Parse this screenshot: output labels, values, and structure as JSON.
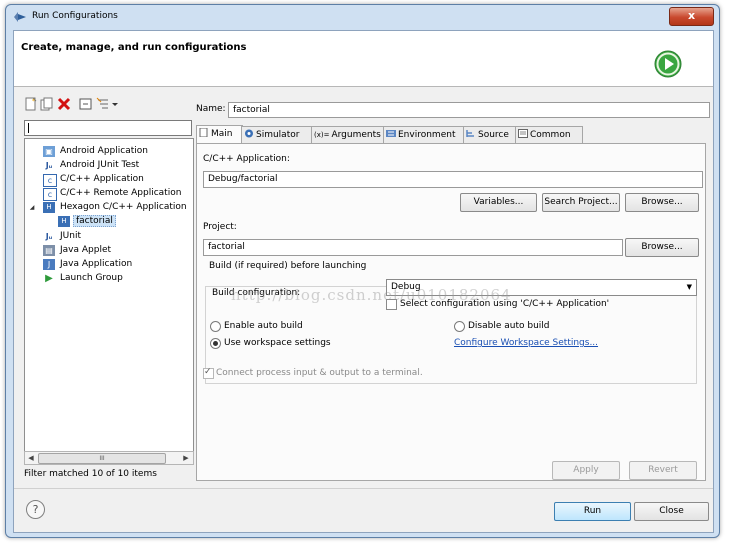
{
  "window": {
    "title": "Run Configurations",
    "close_glyph": "x"
  },
  "header": {
    "title": "Create, manage, and run configurations",
    "logo_icon": "run-icon"
  },
  "left": {
    "toolbar_icons": [
      "new-config-icon",
      "duplicate-icon",
      "delete-icon",
      "collapse-all-icon",
      "filter-icon",
      "dropdown-arrow-icon"
    ],
    "filter_value": "",
    "tree": [
      {
        "label": "Android Application",
        "icon": "android-app-icon",
        "level": 1,
        "expanded": false
      },
      {
        "label": "Android JUnit Test",
        "icon": "junit-icon",
        "level": 1,
        "expanded": false
      },
      {
        "label": "C/C++ Application",
        "icon": "c-icon",
        "level": 1,
        "expanded": false
      },
      {
        "label": "C/C++ Remote Application",
        "icon": "c-icon",
        "level": 1,
        "expanded": false
      },
      {
        "label": "Hexagon C/C++ Application",
        "icon": "hexagon-icon",
        "level": 1,
        "expanded": true
      },
      {
        "label": "factorial",
        "icon": "hexagon-config-icon",
        "level": 2,
        "selected": true
      },
      {
        "label": "JUnit",
        "icon": "junit-icon",
        "level": 1,
        "expanded": false
      },
      {
        "label": "Java Applet",
        "icon": "applet-icon",
        "level": 1,
        "expanded": false
      },
      {
        "label": "Java Application",
        "icon": "java-app-icon",
        "level": 1,
        "expanded": false
      },
      {
        "label": "Launch Group",
        "icon": "launch-group-icon",
        "level": 1,
        "expanded": false
      }
    ],
    "scroll_glyph": "III",
    "filter_status": "Filter matched 10 of 10 items"
  },
  "right": {
    "name_label": "Name:",
    "name_value": "factorial",
    "tabs": [
      {
        "label": "Main",
        "icon": "main-tab-icon",
        "active": true
      },
      {
        "label": "Simulator",
        "icon": "simulator-tab-icon",
        "active": false
      },
      {
        "label": "Arguments",
        "icon": "arguments-tab-icon",
        "icon_text": "(x)=",
        "active": false
      },
      {
        "label": "Environment",
        "icon": "environment-tab-icon",
        "active": false
      },
      {
        "label": "Source",
        "icon": "source-tab-icon",
        "active": false
      },
      {
        "label": "Common",
        "icon": "common-tab-icon",
        "active": false
      }
    ],
    "app_label": "C/C++ Application:",
    "app_value": "Debug/factorial",
    "variables_btn": "Variables...",
    "search_btn": "Search Project...",
    "browse_btn": "Browse...",
    "project_label": "Project:",
    "project_value": "factorial",
    "project_browse_btn": "Browse...",
    "build_group_title": "Build (if required) before launching",
    "build_config_label": "Build configuration:",
    "build_config_value": "Debug",
    "select_config_label": "Select configuration using 'C/C++ Application'",
    "enable_auto_build": "Enable auto build",
    "disable_auto_build": "Disable auto build",
    "use_workspace": "Use workspace settings",
    "configure_workspace_link": "Configure Workspace Settings...",
    "connect_terminal": "Connect process input & output to a terminal.",
    "watermark": "http://blog.csdn.net/u010182064",
    "apply_btn": "Apply",
    "revert_btn": "Revert"
  },
  "footer": {
    "help_glyph": "?",
    "run_btn": "Run",
    "close_btn": "Close"
  }
}
